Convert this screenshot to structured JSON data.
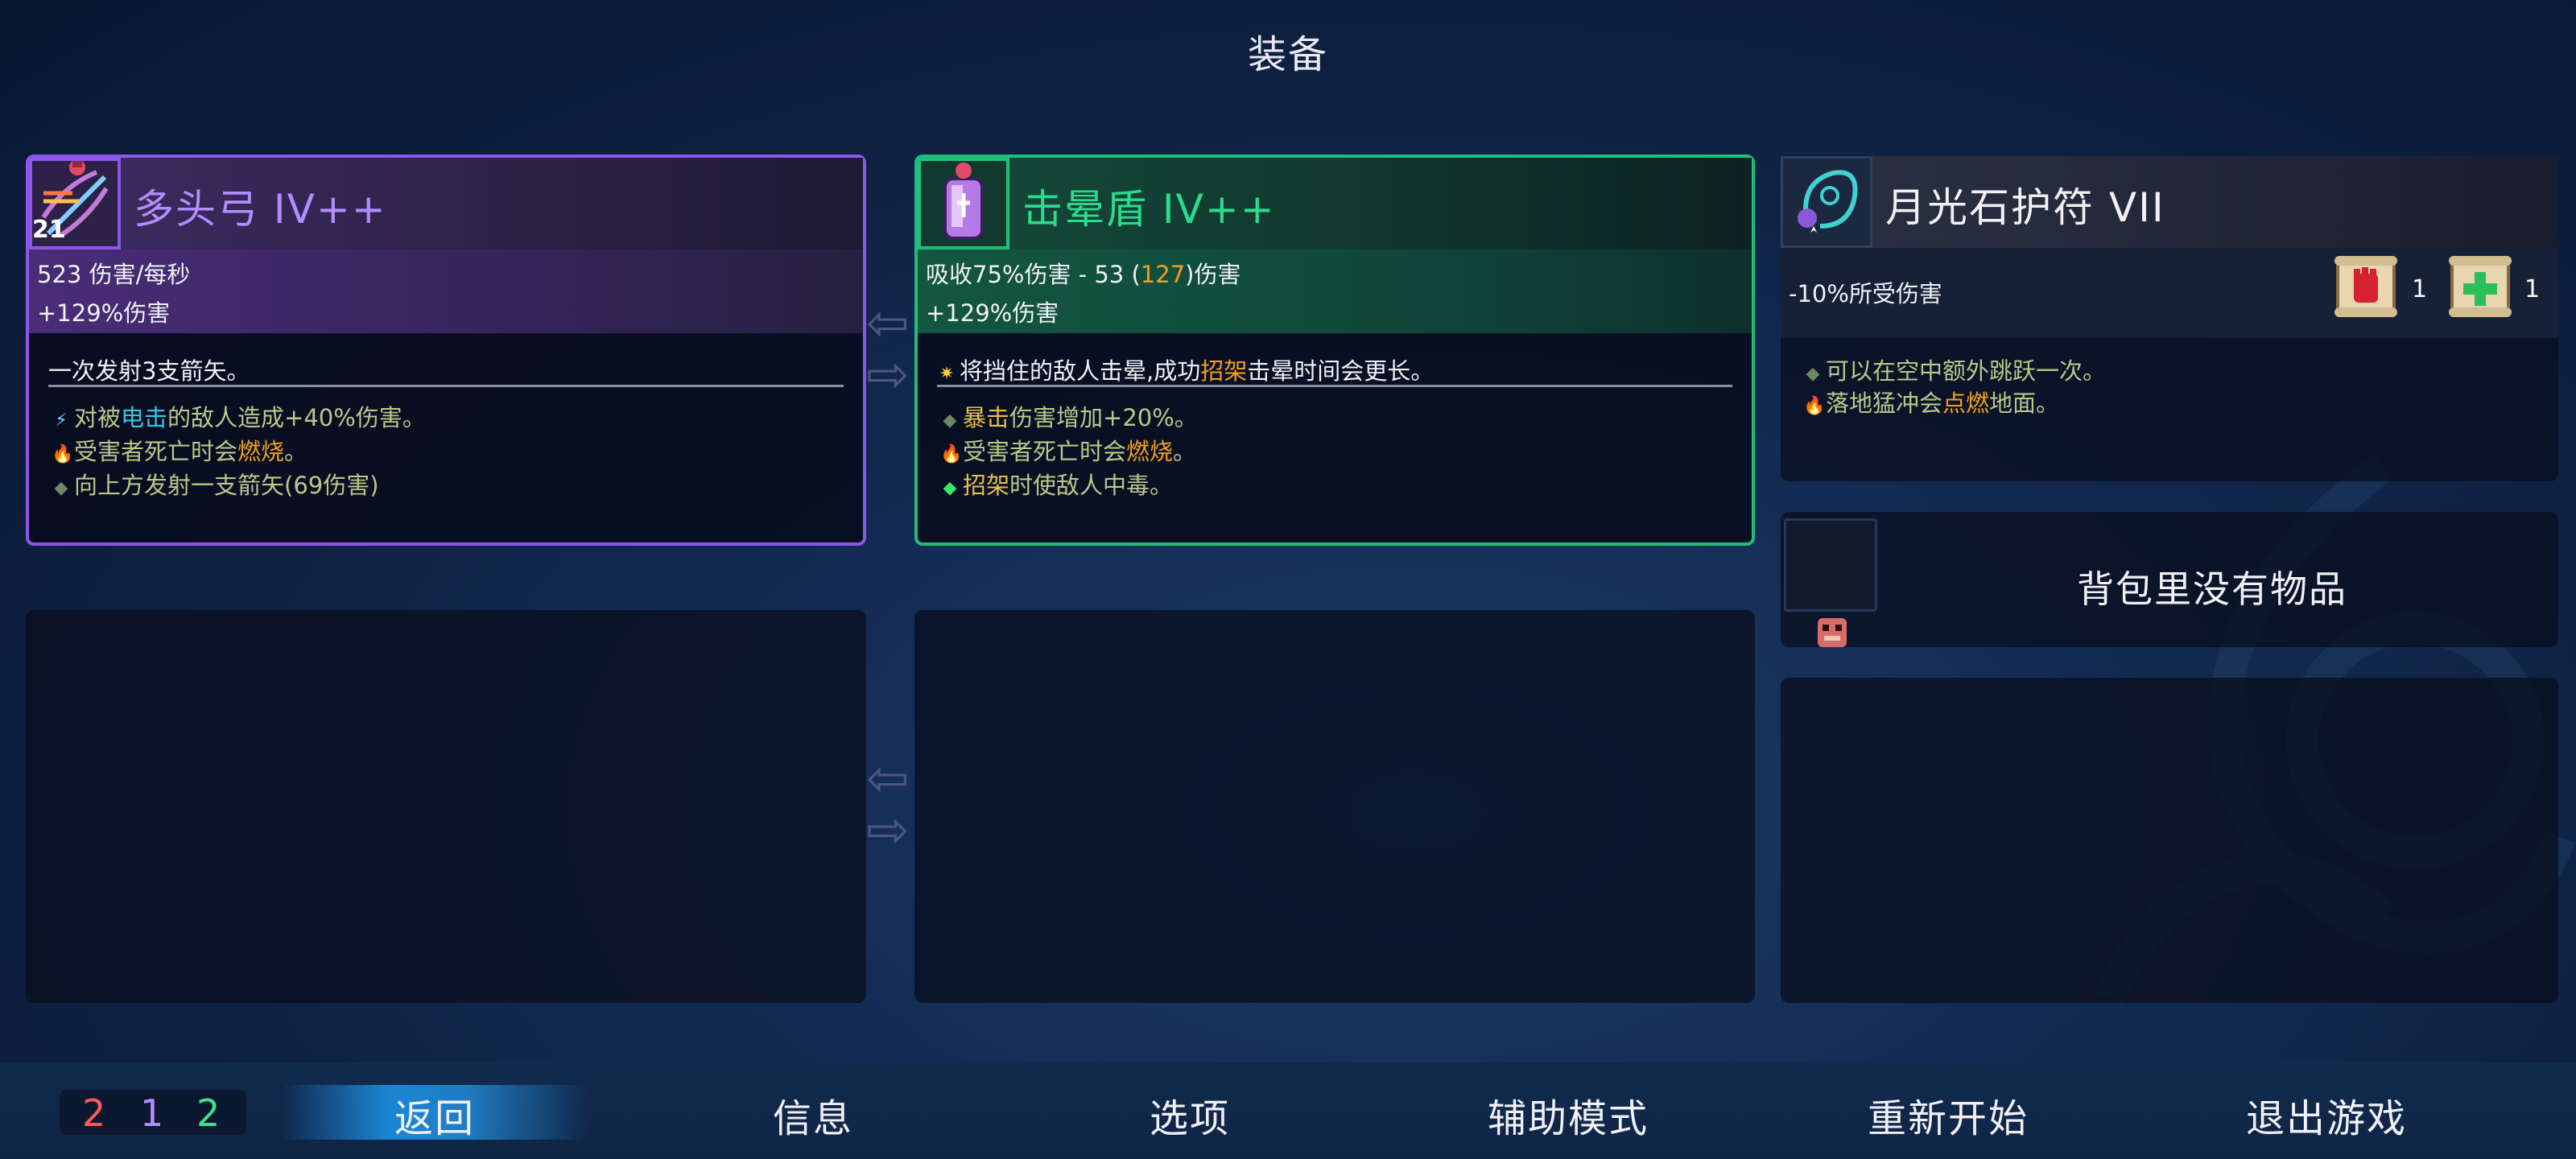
{
  "title": "装备",
  "weapon1": {
    "name": "多头弓 IV++",
    "level": "21",
    "stat1": "523 伤害/每秒",
    "stat2": "+129%伤害",
    "desc": "一次发射3支箭矢。",
    "b1_pre": "对被",
    "b1_hl": "电击",
    "b1_post": "的敌人造成+40%伤害。",
    "b2_pre": "受害者死亡时会",
    "b2_hl": "燃烧",
    "b2_post": "。",
    "b3": "向上方发射一支箭矢(69伤害)"
  },
  "weapon2": {
    "name": "击晕盾 IV++",
    "stat1_pre": "吸收75%伤害 - 53 (",
    "stat1_hl": "127",
    "stat1_post": ")伤害",
    "stat2": "+129%伤害",
    "desc_pre": "将挡住的敌人击晕,成功",
    "desc_hl": "招架",
    "desc_post": "击晕时间会更长。",
    "b1_hl": "暴击",
    "b1_post": "伤害增加+20%。",
    "b2_pre": "受害者死亡时会",
    "b2_hl": "燃烧",
    "b2_post": "。",
    "b3_hl": "招架",
    "b3_post": "时使敌人中毒。"
  },
  "amulet": {
    "name": "月光石护符 VII",
    "stat": "-10%所受伤害",
    "scroll1_count": "1",
    "scroll2_count": "1",
    "b1": "可以在空中额外跳跃一次。",
    "b2_pre": "落地猛冲会",
    "b2_hl": "点燃",
    "b2_post": "地面。"
  },
  "backpack": {
    "text": "背包里没有物品"
  },
  "counter": {
    "red": "2",
    "purple": "1",
    "green": "2"
  },
  "menu": {
    "back": "返回",
    "info": "信息",
    "options": "选项",
    "assist": "辅助模式",
    "restart": "重新开始",
    "quit": "退出游戏"
  },
  "colors": {
    "purple_rarity": "#8c56e8",
    "green_rarity": "#1fbf7b",
    "highlight_orange": "#f0a021",
    "highlight_cyan": "#35c6ea"
  }
}
